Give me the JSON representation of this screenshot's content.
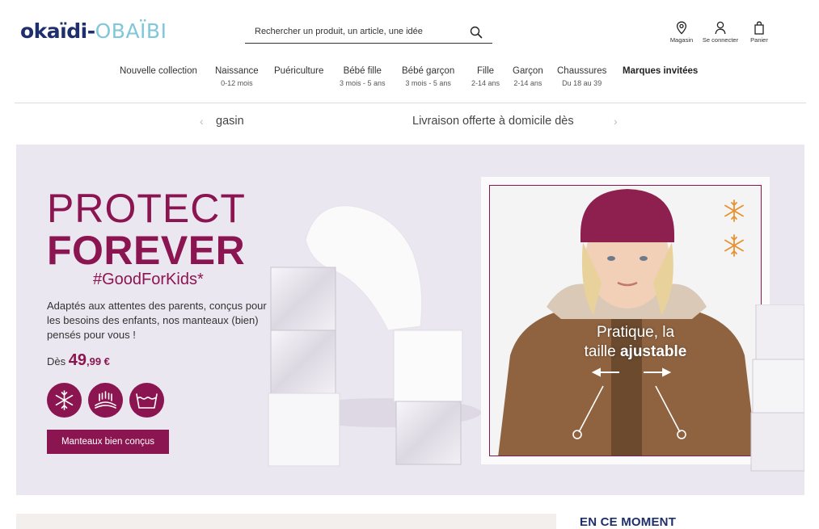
{
  "brand": {
    "okaidi": "okaïdi",
    "dash": "-",
    "obaibi": "OBAÏBI"
  },
  "search": {
    "placeholder": "Rechercher un produit, un article, une idée",
    "icon": "search-icon"
  },
  "utilities": [
    {
      "label": "Magasin",
      "icon": "location-pin-icon"
    },
    {
      "label": "Se connecter",
      "icon": "user-icon"
    },
    {
      "label": "Panier",
      "icon": "shopping-bag-icon"
    }
  ],
  "nav": [
    {
      "label": "Nouvelle collection",
      "sub": ""
    },
    {
      "label": "Naissance",
      "sub": "0-12 mois"
    },
    {
      "label": "Puériculture",
      "sub": ""
    },
    {
      "label": "Bébé fille",
      "sub": "3 mois - 5 ans"
    },
    {
      "label": "Bébé garçon",
      "sub": "3 mois - 5 ans"
    },
    {
      "label": "Fille",
      "sub": "2-14 ans"
    },
    {
      "label": "Garçon",
      "sub": "2-14 ans"
    },
    {
      "label": "Chaussures",
      "sub": "Du 18 au 39"
    },
    {
      "label": "Marques invitées",
      "sub": ""
    }
  ],
  "ticker": {
    "left_text": "gasin",
    "right_text": "Livraison offerte à domicile dès"
  },
  "hero": {
    "title_line1": "PROTECT",
    "title_line2": "FOREVER",
    "hashtag": "#GoodForKids*",
    "description": "Adaptés aux attentes des parents, conçus pour les besoins des enfants, nos manteaux (bien) pensés pour vous !",
    "price_prefix": "Dès ",
    "price_int": "49",
    "price_dec": ",99 €",
    "cta_label": "Manteaux bien conçus",
    "badges": [
      "snowflake-icon",
      "warm-lining-icon",
      "washable-icon"
    ],
    "video_text_line1": "Pratique, la",
    "video_text_line2_plain": "taille ",
    "video_text_line2_bold": "ajustable"
  },
  "bottom": {
    "right_heading": "EN CE MOMENT"
  },
  "colors": {
    "brand_navy": "#1e2f6b",
    "brand_light_blue": "#7fc7d9",
    "accent_plum": "#8b1550",
    "hero_bg": "#ebe7f0",
    "snow_orange": "#e8922e"
  }
}
